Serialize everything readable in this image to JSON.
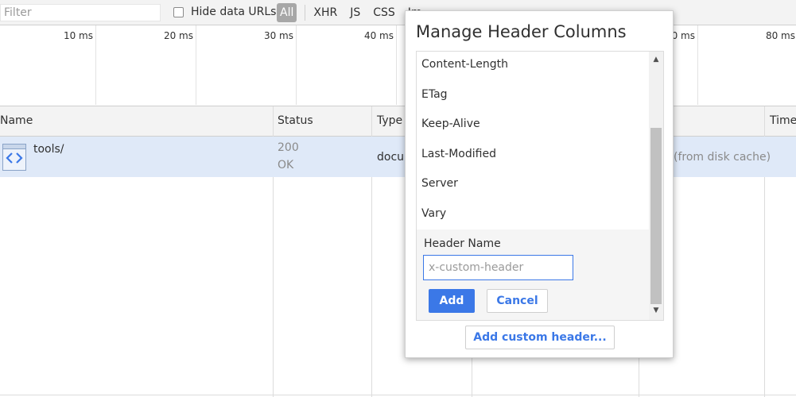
{
  "toolbar": {
    "filter_placeholder": "Filter",
    "hide_data_urls_label": "Hide data URLs",
    "hide_data_urls_checked": false,
    "chips": [
      "All",
      "XHR",
      "JS",
      "CSS",
      "Im"
    ]
  },
  "timeline": {
    "ticks": [
      "10 ms",
      "20 ms",
      "30 ms",
      "40 ms",
      "70 ms",
      "80 ms"
    ]
  },
  "grid": {
    "columns": {
      "name": "Name",
      "status": "Status",
      "type": "Type",
      "time": "Time"
    },
    "rows": [
      {
        "name": "tools/",
        "status_code": "200",
        "status_text": "OK",
        "type": "docu",
        "size": "(from disk cache)"
      }
    ]
  },
  "dialog": {
    "title": "Manage Header Columns",
    "items": [
      "Content-Length",
      "ETag",
      "Keep-Alive",
      "Last-Modified",
      "Server",
      "Vary"
    ],
    "header_name_label": "Header Name",
    "header_input_placeholder": "x-custom-header",
    "add_button": "Add",
    "cancel_button": "Cancel",
    "add_custom_button": "Add custom header..."
  },
  "colors": {
    "accent": "#3b78e7",
    "selected_row": "#dfe9f8",
    "toolbar_bg": "#f3f3f3"
  }
}
